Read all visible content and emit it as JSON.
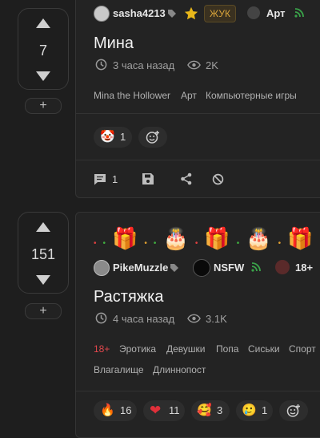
{
  "post1": {
    "score": "7",
    "author": "sasha4213",
    "badge": "ЖУК",
    "community": "Арт",
    "title": "Мина",
    "time": "3 часа назад",
    "views": "2K",
    "tags": [
      "Mina the Hollower",
      "Арт",
      "Компьютерные игры"
    ],
    "reaction_count": "1",
    "comments": "1"
  },
  "post2": {
    "score": "151",
    "author": "PikeMuzzle",
    "community": "NSFW",
    "age_badge": "18+",
    "title": "Растяжка",
    "time": "4 часа назад",
    "views": "3.1K",
    "tags_age": "18+",
    "tags": [
      "Эротика",
      "Девушки",
      "Попа",
      "Сиськи",
      "Спорт",
      "Влагалище",
      "Длиннопост"
    ],
    "reactions": [
      {
        "emoji": "🔥",
        "count": "16"
      },
      {
        "emoji": "❤",
        "count": "11"
      },
      {
        "emoji": "🥰",
        "count": "3"
      },
      {
        "emoji": "🥲",
        "count": "1"
      }
    ]
  },
  "plus_label": "+",
  "colors": {
    "accent_red": "#e0474c",
    "rss_green": "#3aa34a",
    "star": "#e8b71a"
  }
}
